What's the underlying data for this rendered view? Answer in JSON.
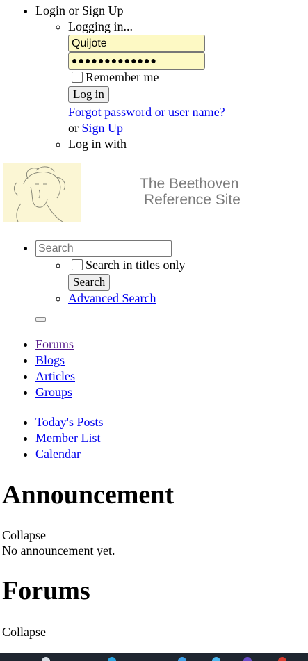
{
  "login": {
    "header": "Login or Sign Up",
    "logging_in": "Logging in...",
    "username_value": "Quijote",
    "password_value": "●●●●●●●●●●●●●",
    "remember": "Remember me",
    "login_button": "Log in",
    "forgot_link": "Forgot password or user name?",
    "or_text": "or",
    "signup_link": "Sign Up",
    "log_in_with": "Log in with"
  },
  "logo": {
    "line1": "The Beethoven",
    "line2": "Reference Site"
  },
  "search": {
    "placeholder": "Search",
    "titles_only": "Search in titles only",
    "button": "Search",
    "advanced": "Advanced Search"
  },
  "nav_primary": [
    "Forums",
    "Blogs",
    "Articles",
    "Groups"
  ],
  "nav_secondary": [
    "Today's Posts",
    "Member List",
    "Calendar"
  ],
  "announcement": {
    "title": "Announcement",
    "collapse": "Collapse",
    "empty": "No announcement yet."
  },
  "forums": {
    "title": "Forums",
    "collapse": "Collapse"
  },
  "colors": {
    "input_autofill": "#fdf9c4",
    "link": "#0000ee",
    "visited_link": "#551a8b",
    "taskbar": "#1f2630"
  }
}
